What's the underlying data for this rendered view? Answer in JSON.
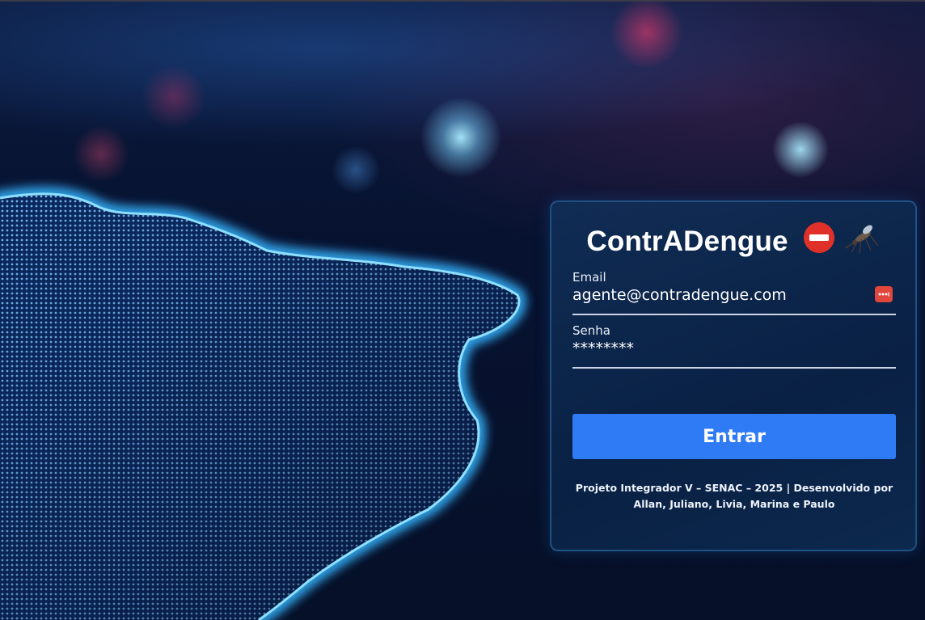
{
  "login": {
    "title": "ContrADengue",
    "title_icons": [
      "no-entry-icon",
      "mosquito-icon"
    ],
    "email_label": "Email",
    "email_value": "agente@contradengue.com",
    "password_label": "Senha",
    "password_value": "********",
    "submit_label": "Entrar",
    "footer_text": "Projeto Integrador V – SENAC – 2025 | Desenvolvido por Allan, Juliano, Livia, Marina e Paulo"
  },
  "colors": {
    "button": "#2f7bf5",
    "card_bg": "#0e2c58",
    "background": "#061028"
  }
}
